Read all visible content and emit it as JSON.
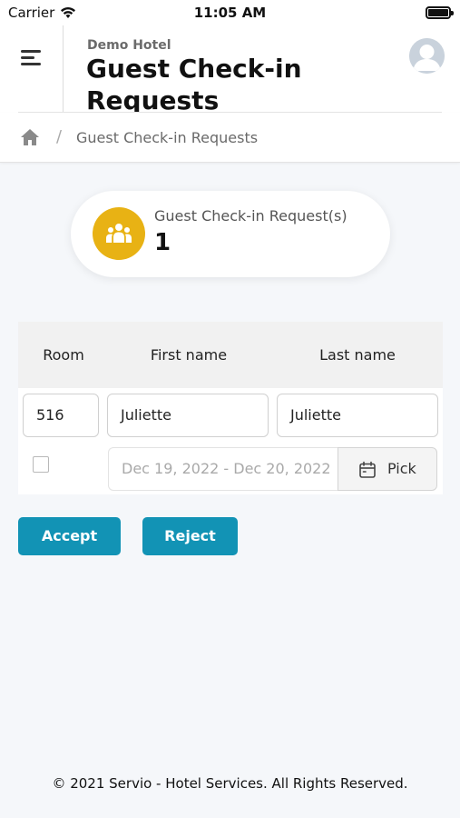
{
  "status_bar": {
    "carrier": "Carrier",
    "time": "11:05 AM",
    "icons": [
      "wifi-icon",
      "battery-icon"
    ]
  },
  "header": {
    "hotel_name": "Demo Hotel",
    "title": "Guest Check-in Requests",
    "menu_icon": "hamburger-menu-icon",
    "avatar_icon": "user-avatar-icon"
  },
  "breadcrumb": {
    "home_icon": "home-icon",
    "separator": "/",
    "current": "Guest Check-in Requests"
  },
  "summary": {
    "icon": "group-people-icon",
    "label": "Guest Check-in Request(s)",
    "count": "1",
    "icon_color": "#e8b214"
  },
  "table": {
    "columns": [
      "Room",
      "First name",
      "Last name"
    ],
    "rows": [
      {
        "room": "516",
        "first_name": "Juliette",
        "last_name": "Juliette",
        "selected": false,
        "date_range": "Dec 19, 2022 - Dec 20, 2022",
        "pick_label": "Pick",
        "pick_icon": "calendar-icon"
      }
    ]
  },
  "actions": {
    "accept_label": "Accept",
    "reject_label": "Reject",
    "button_color": "#1293b5"
  },
  "footer": {
    "copyright": "© 2021 Servio - Hotel Services. All Rights Reserved."
  }
}
